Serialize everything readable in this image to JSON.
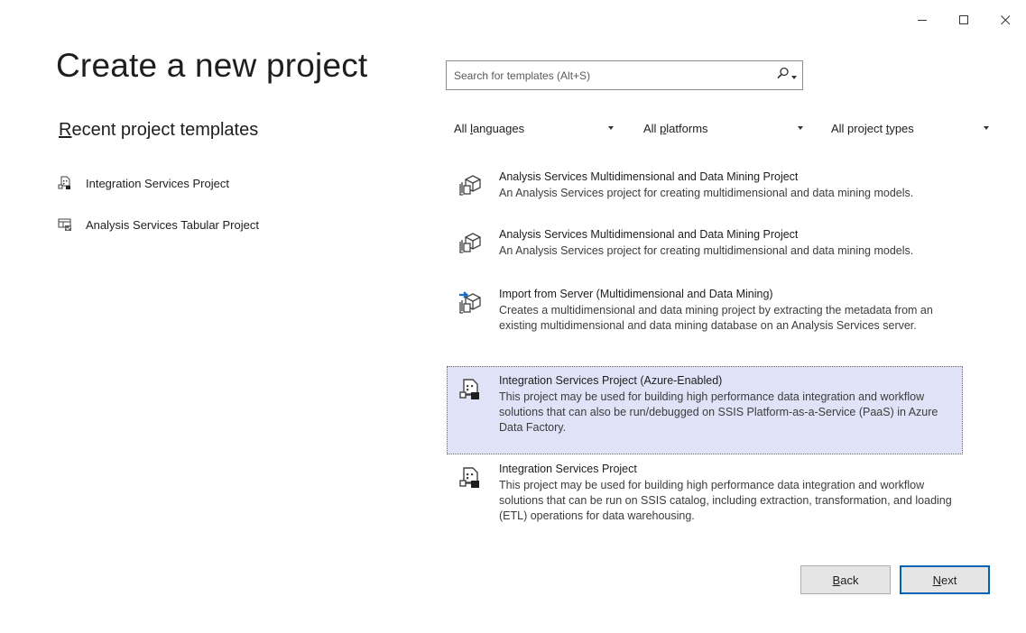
{
  "window": {
    "minimize_icon": "minimize-icon",
    "maximize_icon": "maximize-icon",
    "close_icon": "close-icon"
  },
  "page_title": "Create a new project",
  "recent": {
    "title_mnemonic": "R",
    "title_rest": "ecent project templates",
    "items": [
      {
        "label": "Integration Services Project",
        "icon": "integration-services-icon"
      },
      {
        "label": "Analysis Services Tabular Project",
        "icon": "tabular-project-icon"
      }
    ]
  },
  "search": {
    "placeholder": "Search for templates (Alt+S)",
    "value": ""
  },
  "filters": {
    "language": {
      "before": "All ",
      "mnemonic": "l",
      "after": "anguages"
    },
    "platform": {
      "before": "All ",
      "mnemonic": "p",
      "after": "latforms"
    },
    "project_type": {
      "before": "All project ",
      "mnemonic": "t",
      "after": "ypes"
    }
  },
  "templates": [
    {
      "name": "Analysis Services Multidimensional and Data Mining Project",
      "description": "An Analysis Services project for creating multidimensional and data mining models.",
      "icon": "analysis-services-icon",
      "selected": false
    },
    {
      "name": "Analysis Services Multidimensional and Data Mining Project",
      "description": "An Analysis Services project for creating multidimensional and data mining models.",
      "icon": "analysis-services-icon",
      "selected": false
    },
    {
      "name": "Import from Server (Multidimensional and Data Mining)",
      "description": "Creates a multidimensional  and data mining project by extracting the metadata from an existing multidimensional and data mining database on an Analysis Services server.",
      "icon": "import-from-server-icon",
      "selected": false
    },
    {
      "name": "Integration Services Project (Azure-Enabled)",
      "description": "This project may be used for building high performance data integration and workflow solutions that can also be run/debugged on SSIS Platform-as-a-Service (PaaS) in Azure Data Factory.",
      "icon": "integration-services-icon",
      "selected": true
    },
    {
      "name": "Integration Services Project",
      "description": "This project may be used for building high performance data integration and workflow solutions that can be run on SSIS catalog, including extraction, transformation, and loading (ETL) operations for data warehousing.",
      "icon": "integration-services-icon",
      "selected": false
    }
  ],
  "buttons": {
    "back": {
      "mnemonic": "B",
      "rest": "ack"
    },
    "next": {
      "mnemonic": "N",
      "rest": "ext"
    }
  },
  "colors": {
    "selected_bg": "#e0e2f7",
    "primary_border": "#0063b1"
  }
}
